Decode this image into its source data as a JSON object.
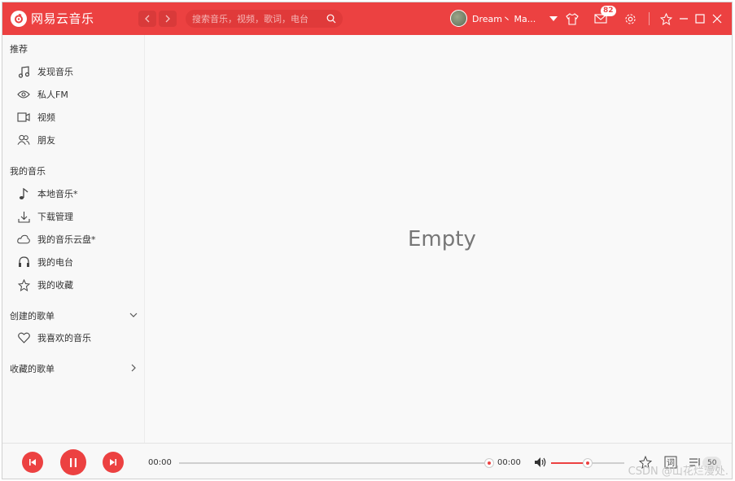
{
  "app": {
    "title": "网易云音乐"
  },
  "search": {
    "placeholder": "搜索音乐，视频，歌词，电台"
  },
  "user": {
    "name": "Dream丶 Ma..."
  },
  "notifications": {
    "count": "82"
  },
  "sidebar": {
    "sections": [
      {
        "title": "推荐",
        "items": [
          {
            "label": "发现音乐",
            "icon": "music-note-icon"
          },
          {
            "label": "私人FM",
            "icon": "eye-icon"
          },
          {
            "label": "视频",
            "icon": "video-icon"
          },
          {
            "label": "朋友",
            "icon": "friends-icon"
          }
        ]
      },
      {
        "title": "我的音乐",
        "items": [
          {
            "label": "本地音乐*",
            "icon": "music-icon"
          },
          {
            "label": "下载管理",
            "icon": "download-icon"
          },
          {
            "label": "我的音乐云盘*",
            "icon": "cloud-icon"
          },
          {
            "label": "我的电台",
            "icon": "headphones-icon"
          },
          {
            "label": "我的收藏",
            "icon": "star-icon"
          }
        ]
      },
      {
        "title": "创建的歌单",
        "items": [
          {
            "label": "我喜欢的音乐",
            "icon": "heart-icon"
          }
        ]
      },
      {
        "title": "收藏的歌单",
        "items": []
      }
    ]
  },
  "main": {
    "empty_text": "Empty"
  },
  "player": {
    "current_time": "00:00",
    "total_time": "00:00",
    "progress": 0,
    "volume": 0.5,
    "lyrics_label": "词",
    "playlist_count": "50"
  },
  "watermark": "CSDN @山花烂漫处.",
  "colors": {
    "accent": "#ec4141",
    "header_bg": "#ec4141",
    "sidebar_bg": "#f8f8f8"
  }
}
